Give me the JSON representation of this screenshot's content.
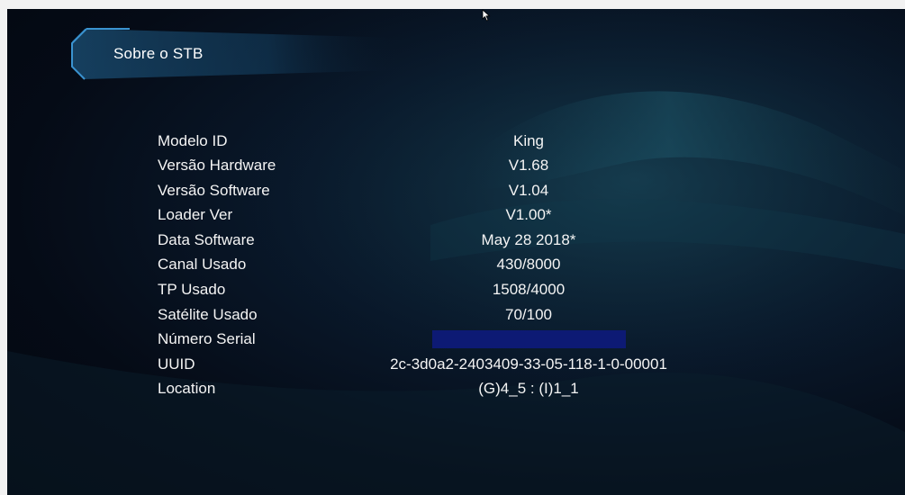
{
  "screen": {
    "title": "Sobre o STB"
  },
  "info": {
    "rows": [
      {
        "label": "Modelo ID",
        "value": "King"
      },
      {
        "label": "Versão Hardware",
        "value": "V1.68"
      },
      {
        "label": "Versão Software",
        "value": "V1.04"
      },
      {
        "label": "Loader Ver",
        "value": "V1.00*"
      },
      {
        "label": "Data Software",
        "value": "May 28 2018*"
      },
      {
        "label": "Canal Usado",
        "value": "430/8000"
      },
      {
        "label": "TP Usado",
        "value": "1508/4000"
      },
      {
        "label": "Satélite Usado",
        "value": "70/100"
      },
      {
        "label": "Número Serial",
        "value": ""
      },
      {
        "label": "UUID",
        "value": "2c-3d0a2-2403409-33-05-118-1-0-00001"
      },
      {
        "label": "Location",
        "value": "(G)4_5 : (I)1_1"
      }
    ]
  },
  "colors": {
    "serial_redaction": "#0d1a74",
    "title_accent": "#2f7fb8",
    "text": "#f4f4f4"
  },
  "icons": {
    "cursor": "mouse-pointer-icon",
    "title_bracket": "corner-bracket-icon"
  }
}
